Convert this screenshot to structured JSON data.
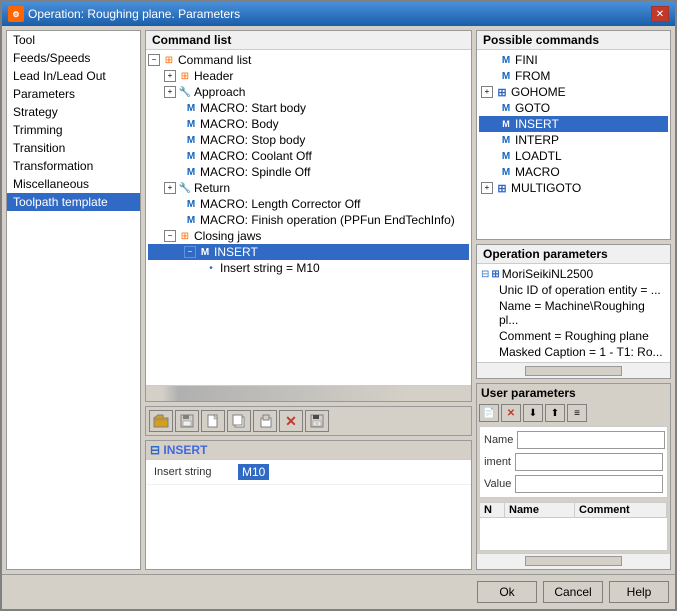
{
  "window": {
    "title": "Operation: Roughing plane. Parameters",
    "icon": "gear-icon"
  },
  "sidebar": {
    "items": [
      {
        "label": "Tool",
        "active": false
      },
      {
        "label": "Feeds/Speeds",
        "active": false
      },
      {
        "label": "Lead In/Lead Out",
        "active": false
      },
      {
        "label": "Parameters",
        "active": false
      },
      {
        "label": "Strategy",
        "active": false
      },
      {
        "label": "Trimming",
        "active": false
      },
      {
        "label": "Transition",
        "active": false
      },
      {
        "label": "Transformation",
        "active": false
      },
      {
        "label": "Miscellaneous",
        "active": false
      },
      {
        "label": "Toolpath template",
        "active": true
      }
    ]
  },
  "command_list": {
    "header": "Command list",
    "items": [
      {
        "level": 0,
        "expand": "root",
        "text": "Command list",
        "icon": "list"
      },
      {
        "level": 0,
        "expand": "expand",
        "text": "Header",
        "icon": "grid"
      },
      {
        "level": 0,
        "expand": "expand",
        "text": "Approach",
        "icon": "wrench"
      },
      {
        "level": 1,
        "expand": null,
        "text": "MACRO: Start body",
        "icon": "blue-m"
      },
      {
        "level": 1,
        "expand": null,
        "text": "MACRO: Body",
        "icon": "blue-m"
      },
      {
        "level": 1,
        "expand": null,
        "text": "MACRO: Stop body",
        "icon": "blue-m"
      },
      {
        "level": 1,
        "expand": null,
        "text": "MACRO: Coolant Off",
        "icon": "blue-m"
      },
      {
        "level": 1,
        "expand": null,
        "text": "MACRO: Spindle Off",
        "icon": "blue-m"
      },
      {
        "level": 0,
        "expand": "expand",
        "text": "Return",
        "icon": "wrench"
      },
      {
        "level": 1,
        "expand": null,
        "text": "MACRO: Length Corrector Off",
        "icon": "blue-m"
      },
      {
        "level": 1,
        "expand": null,
        "text": "MACRO: Finish operation (PPFun EndTechInfo)",
        "icon": "blue-m"
      },
      {
        "level": 0,
        "expand": "collapse",
        "text": "Closing jaws",
        "icon": "grid"
      },
      {
        "level": 1,
        "expand": "collapse",
        "text": "INSERT",
        "icon": "blue-m",
        "selected": true
      },
      {
        "level": 2,
        "expand": null,
        "text": "Insert string = M10",
        "icon": "dot"
      }
    ]
  },
  "toolbar_buttons": [
    {
      "label": "📂",
      "title": "Open"
    },
    {
      "label": "💾",
      "title": "Save"
    },
    {
      "label": "📄",
      "title": "New"
    },
    {
      "label": "📋",
      "title": "Copy"
    },
    {
      "label": "📑",
      "title": "Paste"
    },
    {
      "label": "✕",
      "title": "Delete"
    },
    {
      "label": "🖫",
      "title": "Save file"
    }
  ],
  "insert_panel": {
    "header": "INSERT",
    "row_label": "Insert string",
    "row_value": "M10"
  },
  "possible_commands": {
    "header": "Possible commands",
    "items": [
      {
        "text": "FINI",
        "indent": 1,
        "icon": "blue-m"
      },
      {
        "text": "FROM",
        "indent": 1,
        "icon": "blue-m"
      },
      {
        "text": "GOHOME",
        "indent": 0,
        "expand": true,
        "icon": "grid"
      },
      {
        "text": "GOTO",
        "indent": 1,
        "icon": "blue-m"
      },
      {
        "text": "INSERT",
        "indent": 1,
        "icon": "blue-m",
        "selected": true
      },
      {
        "text": "INTERP",
        "indent": 1,
        "icon": "blue-m"
      },
      {
        "text": "LOADTL",
        "indent": 1,
        "icon": "blue-m"
      },
      {
        "text": "MACRO",
        "indent": 1,
        "icon": "blue-m"
      },
      {
        "text": "MULTIGOTO",
        "indent": 0,
        "expand": true,
        "icon": "grid"
      }
    ]
  },
  "operation_parameters": {
    "header": "Operation parameters",
    "items": [
      {
        "name": "MoriSeikiNL2500",
        "expand": true,
        "value": null
      },
      {
        "name": "Unic ID of operation entity = ...",
        "value": null
      },
      {
        "name": "Name = Machine\\Roughing pl...",
        "value": null
      },
      {
        "name": "Comment = Roughing plane",
        "value": null
      },
      {
        "name": "Masked Caption = 1 - T1: Ro...",
        "value": null
      }
    ]
  },
  "user_parameters": {
    "header": "User parameters",
    "buttons": [
      "📄",
      "✕",
      "⬇",
      "⬆",
      "≡"
    ],
    "fields": [
      {
        "label": "Name",
        "value": ""
      },
      {
        "label": "iment",
        "value": ""
      },
      {
        "label": "Value",
        "value": ""
      }
    ],
    "table_cols": [
      "N",
      "Name",
      "Comment"
    ]
  },
  "bottom_buttons": {
    "ok": "Ok",
    "cancel": "Cancel",
    "help": "Help"
  }
}
